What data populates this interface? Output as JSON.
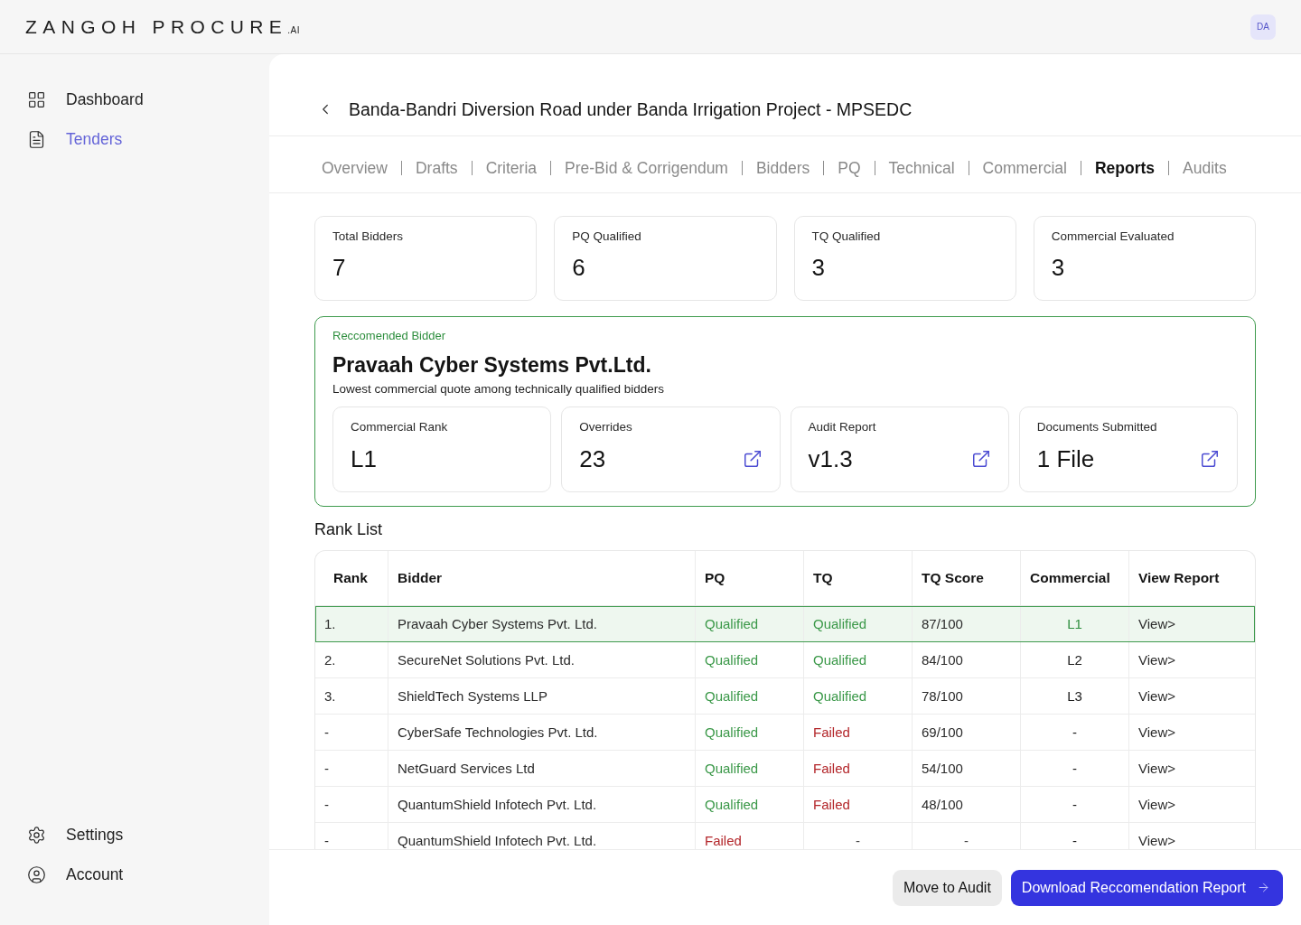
{
  "header": {
    "logo": {
      "name": "ZANGOH PROCURE",
      "suffix": ".AI"
    },
    "avatar": "DA"
  },
  "sidebar": {
    "items": [
      {
        "label": "Dashboard",
        "selected": false
      },
      {
        "label": "Tenders",
        "selected": true
      }
    ],
    "footer_items": [
      {
        "label": "Settings"
      },
      {
        "label": "Account"
      }
    ]
  },
  "page": {
    "title": "Banda-Bandri Diversion Road under Banda Irrigation Project - MPSEDC",
    "tabs": [
      {
        "label": "Overview",
        "selected": false
      },
      {
        "label": "Drafts",
        "selected": false
      },
      {
        "label": "Criteria",
        "selected": false
      },
      {
        "label": "Pre-Bid & Corrigendum",
        "selected": false
      },
      {
        "label": "Bidders",
        "selected": false
      },
      {
        "label": "PQ",
        "selected": false
      },
      {
        "label": "Technical",
        "selected": false
      },
      {
        "label": "Commercial",
        "selected": false
      },
      {
        "label": "Reports",
        "selected": true
      },
      {
        "label": "Audits",
        "selected": false
      }
    ]
  },
  "stats": [
    {
      "label": "Total Bidders",
      "value": "7"
    },
    {
      "label": "PQ Qualified",
      "value": "6"
    },
    {
      "label": "TQ Qualified",
      "value": "3"
    },
    {
      "label": "Commercial Evaluated",
      "value": "3"
    }
  ],
  "recommended": {
    "label": "Reccomended Bidder",
    "name": "Pravaah Cyber Systems Pvt.Ltd.",
    "note": "Lowest commercial quote among technically qualified bidders",
    "metrics": [
      {
        "label": "Commercial Rank",
        "value": "L1",
        "link": false
      },
      {
        "label": "Overrides",
        "value": "23",
        "link": true
      },
      {
        "label": "Audit Report",
        "value": "v1.3",
        "link": true
      },
      {
        "label": "Documents Submitted",
        "value": "1 File",
        "link": true
      }
    ]
  },
  "rank_list": {
    "title": "Rank List",
    "columns": [
      "Rank",
      "Bidder",
      "PQ",
      "TQ",
      "TQ Score",
      "Commercial",
      "View Report"
    ],
    "rows": [
      {
        "selected": true,
        "rank": "1.",
        "bidder": "Pravaah Cyber Systems Pvt. Ltd.",
        "pq": {
          "kind": "result",
          "text": "Qualified",
          "passed": true
        },
        "tq": {
          "kind": "result",
          "text": "Qualified",
          "passed": true
        },
        "score": {
          "kind": "value",
          "text": "87/100"
        },
        "commercial": "L1",
        "view": "View>"
      },
      {
        "selected": false,
        "rank": "2.",
        "bidder": "SecureNet Solutions Pvt. Ltd.",
        "pq": {
          "kind": "result",
          "text": "Qualified",
          "passed": true
        },
        "tq": {
          "kind": "result",
          "text": "Qualified",
          "passed": true
        },
        "score": {
          "kind": "value",
          "text": "84/100"
        },
        "commercial": "L2",
        "view": "View>"
      },
      {
        "selected": false,
        "rank": "3.",
        "bidder": "ShieldTech Systems LLP",
        "pq": {
          "kind": "result",
          "text": "Qualified",
          "passed": true
        },
        "tq": {
          "kind": "result",
          "text": "Qualified",
          "passed": true
        },
        "score": {
          "kind": "value",
          "text": "78/100"
        },
        "commercial": "L3",
        "view": "View>"
      },
      {
        "selected": false,
        "rank": "-",
        "bidder": "CyberSafe Technologies Pvt. Ltd.",
        "pq": {
          "kind": "result",
          "text": "Qualified",
          "passed": true
        },
        "tq": {
          "kind": "result",
          "text": "Failed",
          "passed": false
        },
        "score": {
          "kind": "value",
          "text": "69/100"
        },
        "commercial": "-",
        "view": "View>"
      },
      {
        "selected": false,
        "rank": "-",
        "bidder": "NetGuard Services Ltd",
        "pq": {
          "kind": "result",
          "text": "Qualified",
          "passed": true
        },
        "tq": {
          "kind": "result",
          "text": "Failed",
          "passed": false
        },
        "score": {
          "kind": "value",
          "text": "54/100"
        },
        "commercial": "-",
        "view": "View>"
      },
      {
        "selected": false,
        "rank": "-",
        "bidder": "QuantumShield Infotech Pvt. Ltd.",
        "pq": {
          "kind": "result",
          "text": "Qualified",
          "passed": true
        },
        "tq": {
          "kind": "result",
          "text": "Failed",
          "passed": false
        },
        "score": {
          "kind": "value",
          "text": "48/100"
        },
        "commercial": "-",
        "view": "View>"
      },
      {
        "selected": false,
        "rank": "-",
        "bidder": "QuantumShield Infotech Pvt. Ltd.",
        "pq": {
          "kind": "result",
          "text": "Failed",
          "passed": false
        },
        "tq": {
          "kind": "blank",
          "text": "-"
        },
        "score": {
          "kind": "blank",
          "text": "-"
        },
        "commercial": "-",
        "view": "View>"
      }
    ]
  },
  "footer": {
    "buttons": [
      {
        "label": "Move to Audit",
        "kind": "secondary"
      },
      {
        "label": "Download Reccomendation Report",
        "kind": "primary"
      }
    ]
  }
}
